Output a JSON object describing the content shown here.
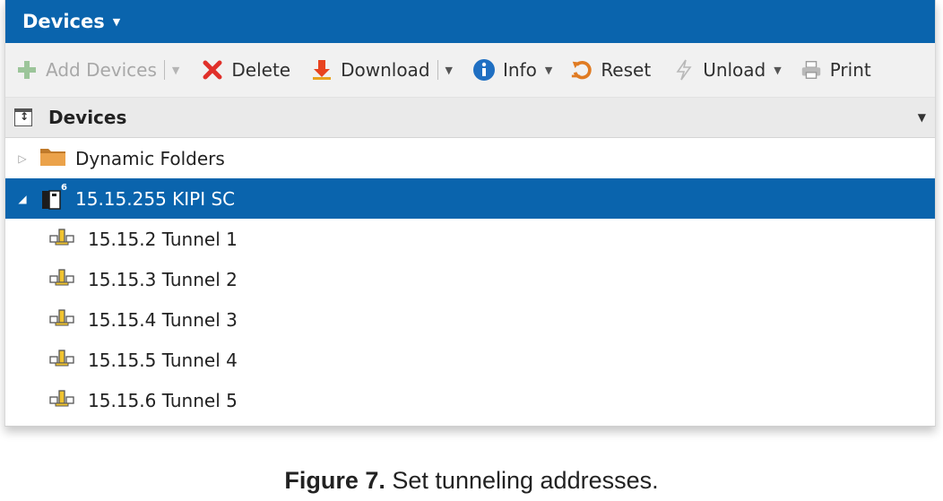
{
  "window": {
    "title": "Devices"
  },
  "toolbar": {
    "add_devices": "Add Devices",
    "delete": "Delete",
    "download": "Download",
    "info": "Info",
    "reset": "Reset",
    "unload": "Unload",
    "print": "Print"
  },
  "panel_header": {
    "title": "Devices"
  },
  "tree": {
    "dynamic_folders": "Dynamic Folders",
    "device": {
      "label": "15.15.255 KIPI SC",
      "badge": "6"
    },
    "children": [
      {
        "label": "15.15.2 Tunnel 1"
      },
      {
        "label": "15.15.3 Tunnel 2"
      },
      {
        "label": "15.15.4 Tunnel 3"
      },
      {
        "label": "15.15.5 Tunnel 4"
      },
      {
        "label": "15.15.6 Tunnel 5"
      }
    ]
  },
  "caption": {
    "figure": "Figure 7.",
    "text": " Set tunneling addresses."
  },
  "colors": {
    "accent": "#0a64ad",
    "toolbar_bg": "#f1f1f1",
    "header_bg": "#eaeaea"
  }
}
